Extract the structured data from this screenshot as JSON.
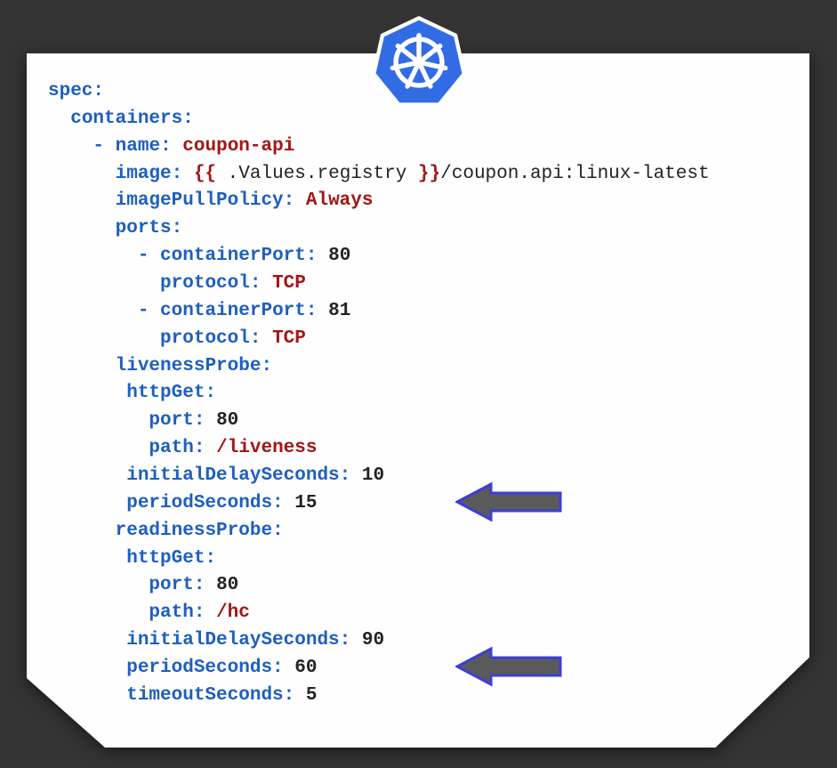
{
  "yaml": {
    "spec_key": "spec",
    "containers_key": "containers",
    "dash": "-",
    "name_key": "name",
    "name_val": "coupon-api",
    "image_key": "image",
    "image_tpl_open": "{{",
    "image_tpl_inner": " .Values.registry ",
    "image_tpl_close": "}}",
    "image_tpl_suffix": "/coupon.api:linux-latest",
    "imagePullPolicy_key": "imagePullPolicy",
    "imagePullPolicy_val": "Always",
    "ports_key": "ports",
    "containerPort_key": "containerPort",
    "protocol_key": "protocol",
    "protocol_val": "TCP",
    "port80": "80",
    "port81": "81",
    "livenessProbe_key": "livenessProbe",
    "readinessProbe_key": "readinessProbe",
    "httpGet_key": "httpGet",
    "port_key": "port",
    "path_key": "path",
    "liveness_path_val": "/liveness",
    "hc_path_val": "/hc",
    "initialDelaySeconds_key": "initialDelaySeconds",
    "periodSeconds_key": "periodSeconds",
    "timeoutSeconds_key": "timeoutSeconds",
    "live_initialDelay": "10",
    "live_period": "15",
    "ready_initialDelay": "90",
    "ready_period": "60",
    "ready_timeout": "5"
  },
  "colors": {
    "key": "#1d5fbf",
    "string": "#a31515",
    "arrow_fill": "#5a5a5a",
    "arrow_stroke": "#3b3fd6",
    "k8s_blue": "#326ce5"
  }
}
